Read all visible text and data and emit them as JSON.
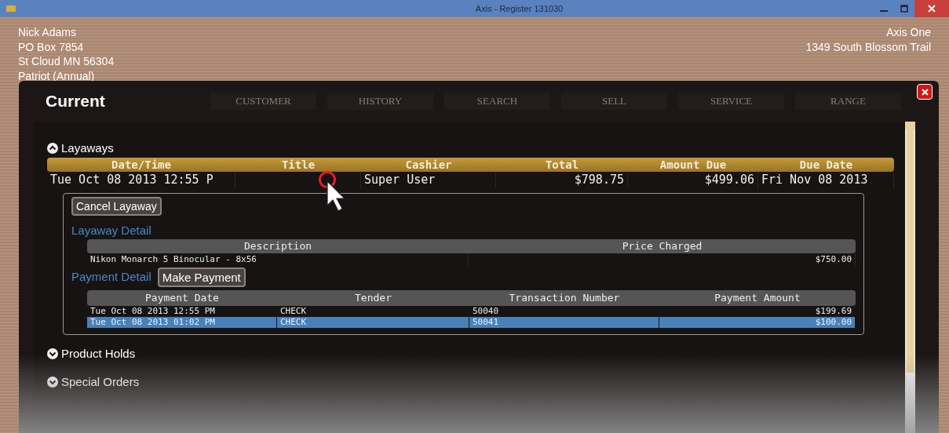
{
  "window": {
    "title": "Axis - Register  131030"
  },
  "customer": {
    "lines": [
      "Nick Adams",
      "PO Box 7854",
      "St Cloud MN 56304",
      "Patriot (Annual)"
    ]
  },
  "store": {
    "lines": [
      "Axis One",
      "1349 South Blossom Trail"
    ]
  },
  "background_tabs": [
    {
      "label": "CUSTOMER"
    },
    {
      "label": "HISTORY"
    },
    {
      "label": "SEARCH"
    },
    {
      "label": "SELL"
    },
    {
      "label": "SERVICE"
    },
    {
      "label": "RANGE"
    }
  ],
  "dialog": {
    "title": "Current",
    "sections": [
      {
        "title": "Layaways",
        "expanded": true,
        "table": {
          "columns": [
            "Date/Time",
            "Title",
            "Cashier",
            "Total",
            "Amount Due",
            "Due Date"
          ],
          "rows": [
            {
              "cells": [
                "Tue Oct 08 2013 12:55 P",
                "",
                "Super User",
                "$798.75",
                "$499.06",
                "Fri Nov 08 2013"
              ]
            }
          ]
        },
        "detail": {
          "cancel_button": "Cancel Layaway",
          "layaway_heading": "Layaway Detail",
          "items": {
            "columns": [
              "Description",
              "Price Charged"
            ],
            "rows": [
              {
                "cells": [
                  "Nikon Monarch 5 Binocular - 8x56",
                  "$750.00"
                ]
              }
            ]
          },
          "payment_heading": "Payment Detail",
          "payment_button": "Make Payment",
          "payments": {
            "columns": [
              "Payment Date",
              "Tender",
              "Transaction Number",
              "Payment Amount"
            ],
            "rows": [
              {
                "cells": [
                  "Tue Oct 08 2013 12:55 PM",
                  "CHECK",
                  "50040",
                  "$199.69"
                ],
                "selected": false
              },
              {
                "cells": [
                  "Tue Oct 08 2013 01:02 PM",
                  "CHECK",
                  "50041",
                  "$100.00"
                ],
                "selected": true
              }
            ]
          }
        }
      },
      {
        "title": "Product Holds",
        "expanded": false
      },
      {
        "title": "Special Orders",
        "expanded": false
      }
    ]
  }
}
